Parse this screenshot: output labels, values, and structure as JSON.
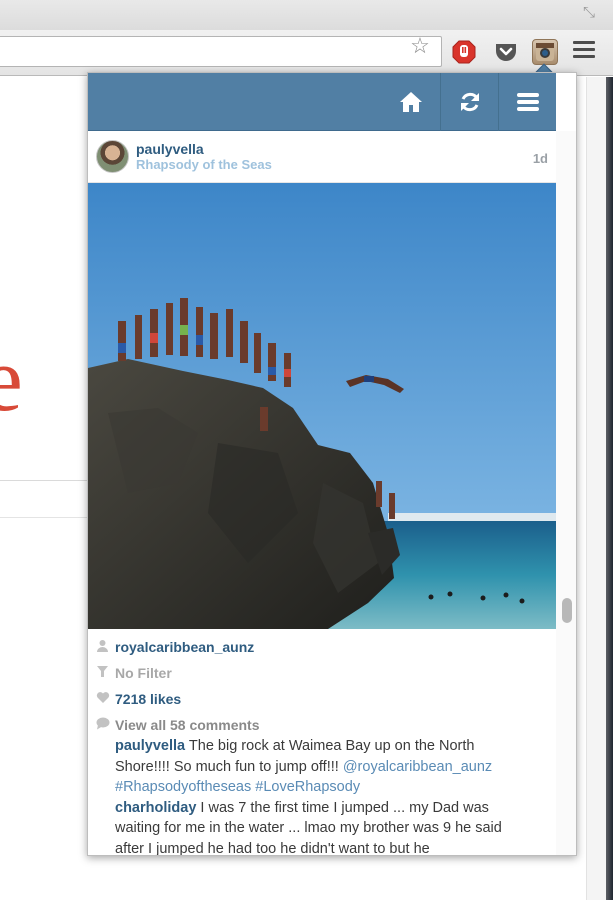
{
  "browser": {
    "resize_icon": "resize-icon",
    "omnibox_icons": [
      "star-icon"
    ],
    "extensions": [
      "ublock-icon",
      "pocket-icon",
      "instagram-extension-icon"
    ],
    "menu_icon": "chrome-menu-icon"
  },
  "background_page": {
    "partial_letter": "e"
  },
  "popup": {
    "nav": {
      "icons": [
        "home-icon",
        "refresh-icon",
        "menu-icon"
      ],
      "color": "#517fa4"
    },
    "post": {
      "username": "paulyvella",
      "location": "Rhapsody of the Seas",
      "time_ago": "1d",
      "tagged_user": "royalcaribbean_aunz",
      "filter": "No Filter",
      "likes": "7218 likes",
      "view_all_comments": "View all 58 comments",
      "comments": [
        {
          "user": "paulyvella",
          "text": "The big rock at Waimea Bay up on the North Shore!!!! So much fun to jump off!!! ",
          "mention": "@royalcaribbean_aunz",
          "hashtags": "#Rhapsodyoftheseas #LoveRhapsody"
        },
        {
          "user": "charholiday",
          "text": "I was 7 the first time I jumped ... my Dad was waiting for me in the water ... lmao my brother was 9 he said after I jumped he had too he didn't want to but he"
        }
      ]
    }
  }
}
